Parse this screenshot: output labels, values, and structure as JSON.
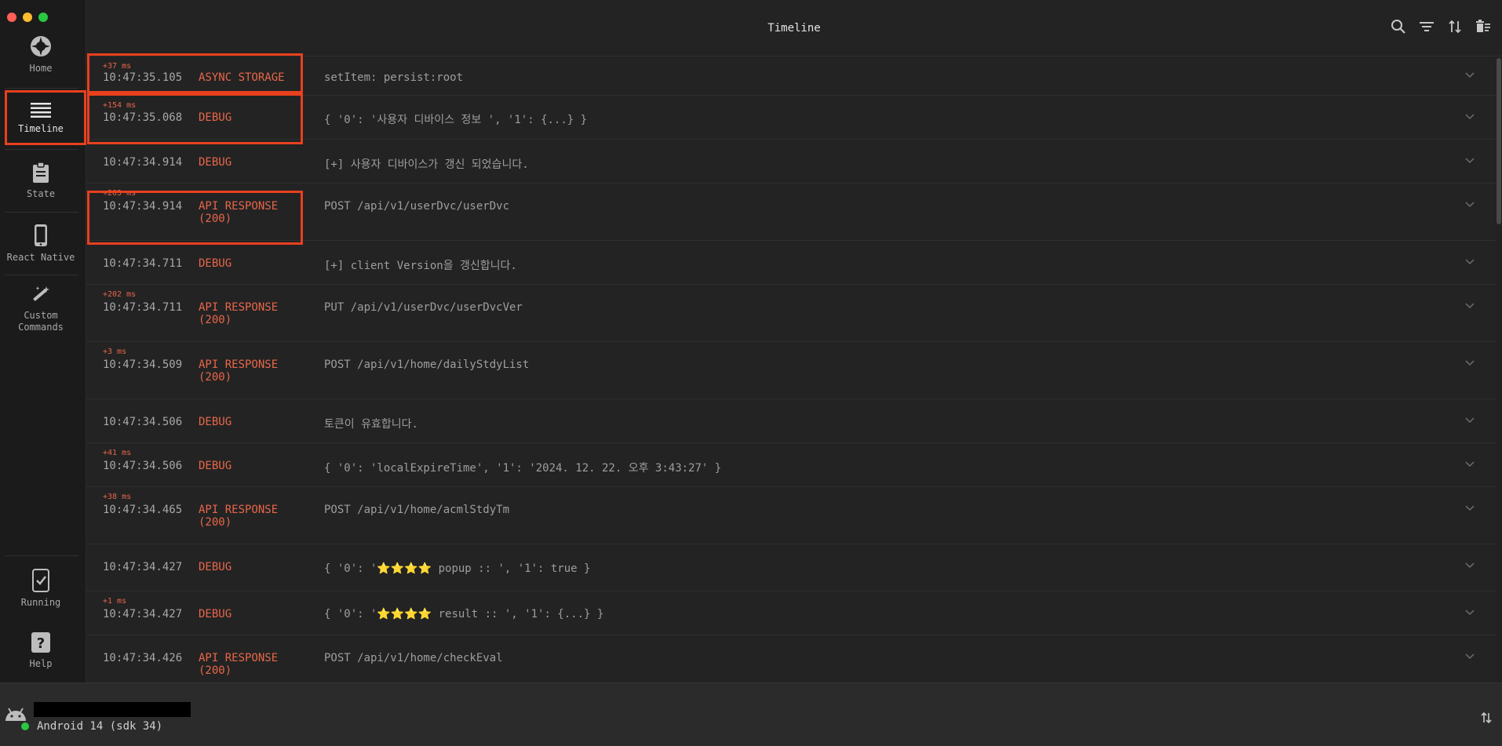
{
  "header": {
    "title": "Timeline"
  },
  "sidebar": {
    "items": [
      {
        "label": "Home",
        "icon": "home-icon"
      },
      {
        "label": "Timeline",
        "icon": "timeline-icon"
      },
      {
        "label": "State",
        "icon": "clipboard-icon"
      },
      {
        "label": "React Native",
        "icon": "phone-icon"
      },
      {
        "label": "Custom\nCommands",
        "icon": "magic-wand-icon"
      },
      {
        "label": "Running",
        "icon": "running-icon"
      },
      {
        "label": "Help",
        "icon": "help-icon"
      }
    ],
    "active": "Timeline"
  },
  "rows": [
    {
      "delta": "+37 ms",
      "time": "10:47:35.105",
      "type": "ASYNC STORAGE",
      "msg": "setItem: persist:root"
    },
    {
      "delta": "+154 ms",
      "time": "10:47:35.068",
      "type": "DEBUG",
      "msg": "{ '0': '사용자 디바이스 정보 ', '1': {...} }"
    },
    {
      "delta": "",
      "time": "10:47:34.914",
      "type": "DEBUG",
      "msg": "[+] 사용자 디바이스가 갱신 되었습니다."
    },
    {
      "delta": "+203 ms",
      "time": "10:47:34.914",
      "type": "API RESPONSE\n(200)",
      "msg": "POST /api/v1/userDvc/userDvc"
    },
    {
      "delta": "",
      "time": "10:47:34.711",
      "type": "DEBUG",
      "msg": "[+] client Version을 갱신합니다."
    },
    {
      "delta": "+202 ms",
      "time": "10:47:34.711",
      "type": "API RESPONSE\n(200)",
      "msg": "PUT /api/v1/userDvc/userDvcVer"
    },
    {
      "delta": "+3 ms",
      "time": "10:47:34.509",
      "type": "API RESPONSE\n(200)",
      "msg": "POST /api/v1/home/dailyStdyList"
    },
    {
      "delta": "",
      "time": "10:47:34.506",
      "type": "DEBUG",
      "msg": "토큰이 유효합니다."
    },
    {
      "delta": "+41 ms",
      "time": "10:47:34.506",
      "type": "DEBUG",
      "msg": "{ '0': 'localExpireTime', '1': '2024. 12. 22. 오후 3:43:27' }"
    },
    {
      "delta": "+38 ms",
      "time": "10:47:34.465",
      "type": "API RESPONSE\n(200)",
      "msg": "POST /api/v1/home/acmlStdyTm"
    },
    {
      "delta": "",
      "time": "10:47:34.427",
      "type": "DEBUG",
      "msg": "{ '0': '⭐⭐⭐⭐ popup :: ', '1': true }"
    },
    {
      "delta": "+1 ms",
      "time": "10:47:34.427",
      "type": "DEBUG",
      "msg": "{ '0': '⭐⭐⭐⭐ result :: ', '1': {...} }"
    },
    {
      "delta": "",
      "time": "10:47:34.426",
      "type": "API RESPONSE\n(200)",
      "msg": "POST /api/v1/home/checkEval"
    }
  ],
  "footer": {
    "device_os": "Android 14 (sdk 34)"
  }
}
